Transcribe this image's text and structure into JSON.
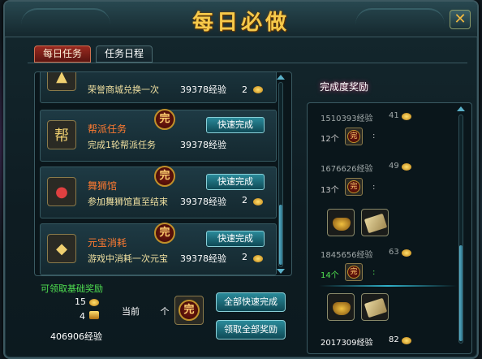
{
  "window": {
    "title": "每日必做",
    "close_label": "✕"
  },
  "tabs": [
    {
      "label": "每日任务",
      "active": true
    },
    {
      "label": "任务日程",
      "active": false
    }
  ],
  "tasks": [
    {
      "name": "",
      "desc": "荣誉商城兑换一次",
      "exp": "39378经验",
      "count": "2",
      "icon": "shop-icon",
      "quick_label": ""
    },
    {
      "name": "帮派任务",
      "desc": "完成1轮帮派任务",
      "exp": "39378经验",
      "count": "",
      "icon": "guild-icon",
      "quick_label": "快速完成"
    },
    {
      "name": "舞狮馆",
      "desc": "参加舞狮馆直至结束",
      "exp": "39378经验",
      "count": "2",
      "icon": "lion-icon",
      "quick_label": "快速完成"
    },
    {
      "name": "元宝消耗",
      "desc": "游戏中消耗一次元宝",
      "exp": "39378经验",
      "count": "2",
      "icon": "ingot-icon",
      "quick_label": "快速完成"
    }
  ],
  "seal_char": "完",
  "base_reward": {
    "title": "可领取基础奖励",
    "coin_count": "15",
    "gold_count": "4",
    "current_label": "当前",
    "current_unit": "个",
    "total_exp": "406906经验"
  },
  "buttons": {
    "complete_all": "全部快速完成",
    "claim_all": "领取全部奖励"
  },
  "reward_panel": {
    "title": "完成度奖励",
    "tiers": [
      {
        "exp": "1510393经验",
        "coins": "41",
        "req": "12个",
        "colon": ":"
      },
      {
        "exp": "1676626经验",
        "coins": "49",
        "req": "13个",
        "colon": ":"
      },
      {
        "exp": "1845656经验",
        "coins": "63",
        "req": "14个",
        "colon": ":"
      },
      {
        "exp": "2017309经验",
        "coins": "82",
        "req": "",
        "colon": ""
      }
    ]
  },
  "colors": {
    "title_gold": "#f6c94a",
    "task_name": "#ff7a30",
    "green_text": "#50e050",
    "button_teal": "#2a8a9a"
  }
}
